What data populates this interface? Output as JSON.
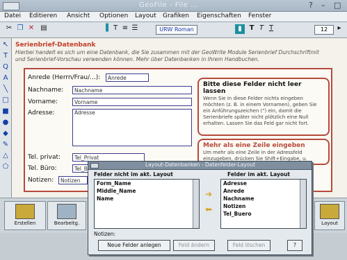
{
  "window": {
    "title": "GeoFile - File ...",
    "controls": [
      "?",
      "–",
      "□"
    ]
  },
  "menu": [
    "Datei",
    "Editieren",
    "Ansicht",
    "Optionen",
    "Layout",
    "Grafiken",
    "Eigenschaften",
    "Fenster"
  ],
  "toolbar": {
    "font": "URW Roman",
    "size": "12",
    "styles": [
      "T",
      "T",
      "T"
    ]
  },
  "palette_icons": [
    "arrow-icon",
    "text-icon",
    "zoom-icon",
    "letter-a-icon",
    "line-icon",
    "rect-icon",
    "square-icon",
    "circle-icon",
    "fill-icon",
    "pen-icon",
    "triangle-icon",
    "shape-icon"
  ],
  "doc": {
    "heading": "Serienbrief-Datenbank",
    "intro": "Hierbei handelt es sich um eine Datenbank, die Sie zusammen mit der GeoWrite Module Serienbrief Durchschriftmit und Serienbrief-Vorschau verwenden können. Mehr über Datenbanken in Ihrem Handbuchen."
  },
  "form": {
    "anrede_label": "Anrede (Herrn/Frau/...):",
    "anrede_value": "Anrede",
    "nachname_label": "Nachname:",
    "nachname_value": "Nachname",
    "vorname_label": "Vorname:",
    "vorname_value": "Vorname",
    "adresse_label": "Adresse:",
    "adresse_value": "Adresse",
    "telprivat_label": "Tel. privat:",
    "telprivat_value": "Tel_Privat",
    "telbuero_label": "Tel. Büro:",
    "telbuero_value": "Tel_B",
    "notizen_label": "Notizen:",
    "notizen_value": "Notizen"
  },
  "infobox1": {
    "title": "Bitte diese Felder nicht leer lassen",
    "text": "Wenn Sie in diese Felder nichts eingeben möchten (z. B. in einem Vornamen), geben Sie ein Anführungszeichen (\") ein, damit die Serienbriefe später nicht plötzlich eine Null erhalten. Lassen Sie das Feld gar nicht fort."
  },
  "infobox2": {
    "title": "Mehr als eine Zeile eingeben",
    "text": "Um mehr als eine Zeile in der Adressfeld einzugeben, drücken Sie Shift+Eingabe, u."
  },
  "iconbar": {
    "buttons": [
      "Erstellen",
      "Bearbeitg."
    ],
    "right_label": "Layout"
  },
  "dialog": {
    "title": "Layout-Datenbanken - Datenfelder-Layout",
    "left_header": "Felder nicht im akt. Layout",
    "right_header": "Felder im akt. Layout",
    "left_items": [
      "Form_Name",
      "Middle_Name",
      "Name"
    ],
    "right_items": [
      "Adresse",
      "Anrede",
      "Nachname",
      "Notizen",
      "Tel_Buero"
    ],
    "note_label": "Notizen:",
    "buttons": {
      "new": "Neue Felder anlegen",
      "edit": "Feld ändern",
      "delete": "Feld löschen",
      "help": "?"
    }
  },
  "colors": {
    "accent_red": "#b54a3b",
    "accent_blue": "#3b3b8f",
    "teal": "#1c8fa0",
    "gold": "#d6a31e"
  }
}
